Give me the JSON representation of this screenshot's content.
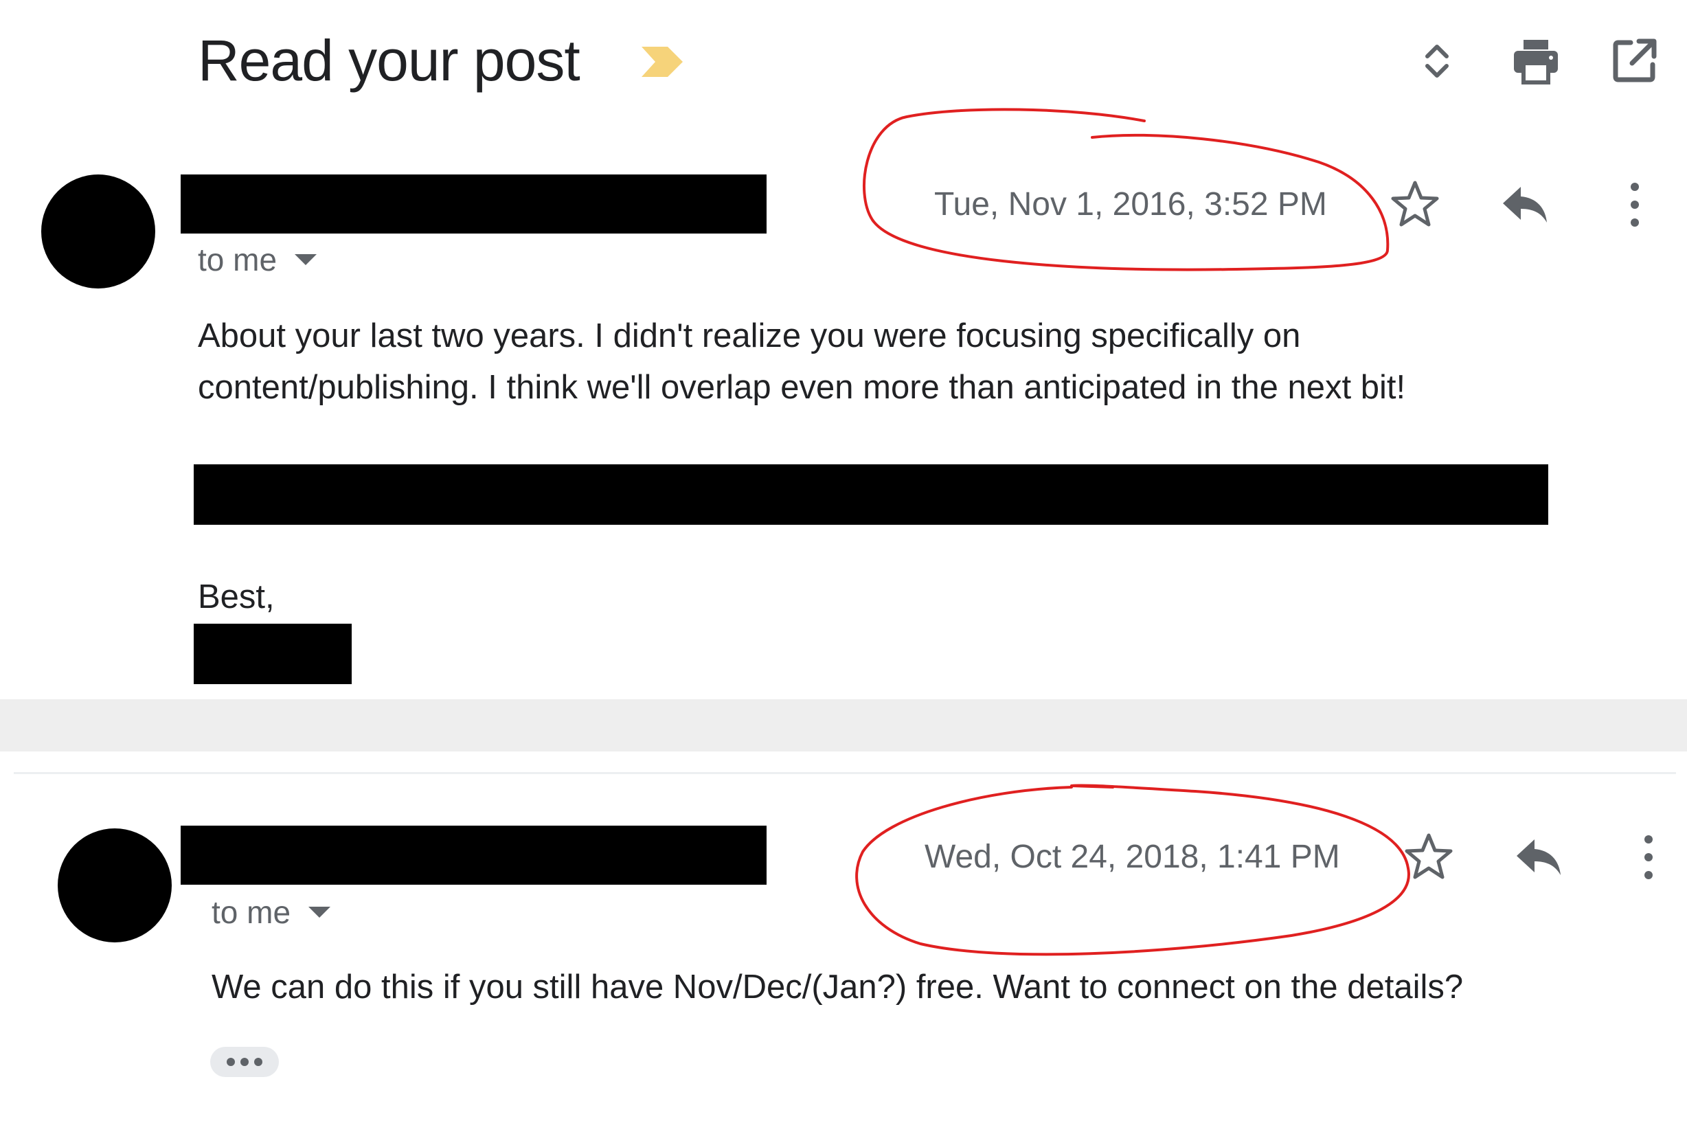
{
  "thread": {
    "subject": "Read your post",
    "toolbar": {
      "expand_icon": "unfold-icon",
      "print_icon": "print-icon",
      "popout_icon": "open-in-new-icon"
    }
  },
  "messages": [
    {
      "recipient": "to me",
      "date": "Tue, Nov 1, 2016, 3:52 PM",
      "body_lines": [
        "About your last two years. I didn't realize you were focusing specifically on",
        "content/publishing. I think we'll overlap even more than anticipated in the next bit!"
      ],
      "signoff": "Best,"
    },
    {
      "recipient": "to me",
      "date": "Wed, Oct 24, 2018, 1:41 PM",
      "body_lines": [
        "We can do this if you still have Nov/Dec/(Jan?) free. Want to connect on the details?"
      ]
    }
  ],
  "colors": {
    "importance_marker": "#f6d37a",
    "annotation_red": "#e02020",
    "muted_text": "#5f6368"
  }
}
